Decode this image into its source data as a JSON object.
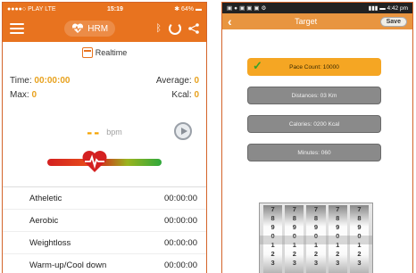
{
  "hrm_screen": {
    "status": {
      "carrier": "●●●●○ PLAY  LTE",
      "time": "15:19",
      "battery": "64%"
    },
    "header": {
      "title": "HRM"
    },
    "mode_label": "Realtime",
    "stats": {
      "time_label": "Time:",
      "time_value": "00:00:00",
      "average_label": "Average:",
      "average_value": "0",
      "max_label": "Max:",
      "max_value": "0",
      "kcal_label": "Kcal:",
      "kcal_value": "0"
    },
    "heart_rate": {
      "value": "--",
      "unit": "bpm"
    },
    "zones": [
      {
        "name": "Atheletic",
        "time": "00:00:00"
      },
      {
        "name": "Aerobic",
        "time": "00:00:00"
      },
      {
        "name": "Weightloss",
        "time": "00:00:00"
      },
      {
        "name": "Warm-up/Cool down",
        "time": "00:00:00"
      }
    ],
    "colors": {
      "accent": "#e8731f",
      "value": "#e8a21f",
      "bpm": "#f5a300"
    }
  },
  "target_screen": {
    "status": {
      "time": "4:42 pm"
    },
    "header": {
      "title": "Target",
      "save_label": "Save"
    },
    "options": [
      {
        "label": "Pace Count: 10000",
        "selected": true
      },
      {
        "label": "Distances: 03 Km",
        "selected": false
      },
      {
        "label": "Calories: 0200 Kcal",
        "selected": false
      },
      {
        "label": "Minutes: 060",
        "selected": false
      }
    ],
    "picker_columns": [
      [
        "7",
        "8",
        "9",
        "0",
        "1",
        "2",
        "3"
      ],
      [
        "7",
        "8",
        "9",
        "0",
        "1",
        "2",
        "3"
      ],
      [
        "7",
        "8",
        "9",
        "0",
        "1",
        "2",
        "3"
      ],
      [
        "7",
        "8",
        "9",
        "0",
        "1",
        "2",
        "3"
      ],
      [
        "7",
        "8",
        "9",
        "0",
        "1",
        "2",
        "3"
      ]
    ],
    "colors": {
      "header": "#e89540",
      "selected": "#f5a623",
      "unselected": "#8a8a8a",
      "check": "#3aa12a"
    }
  }
}
